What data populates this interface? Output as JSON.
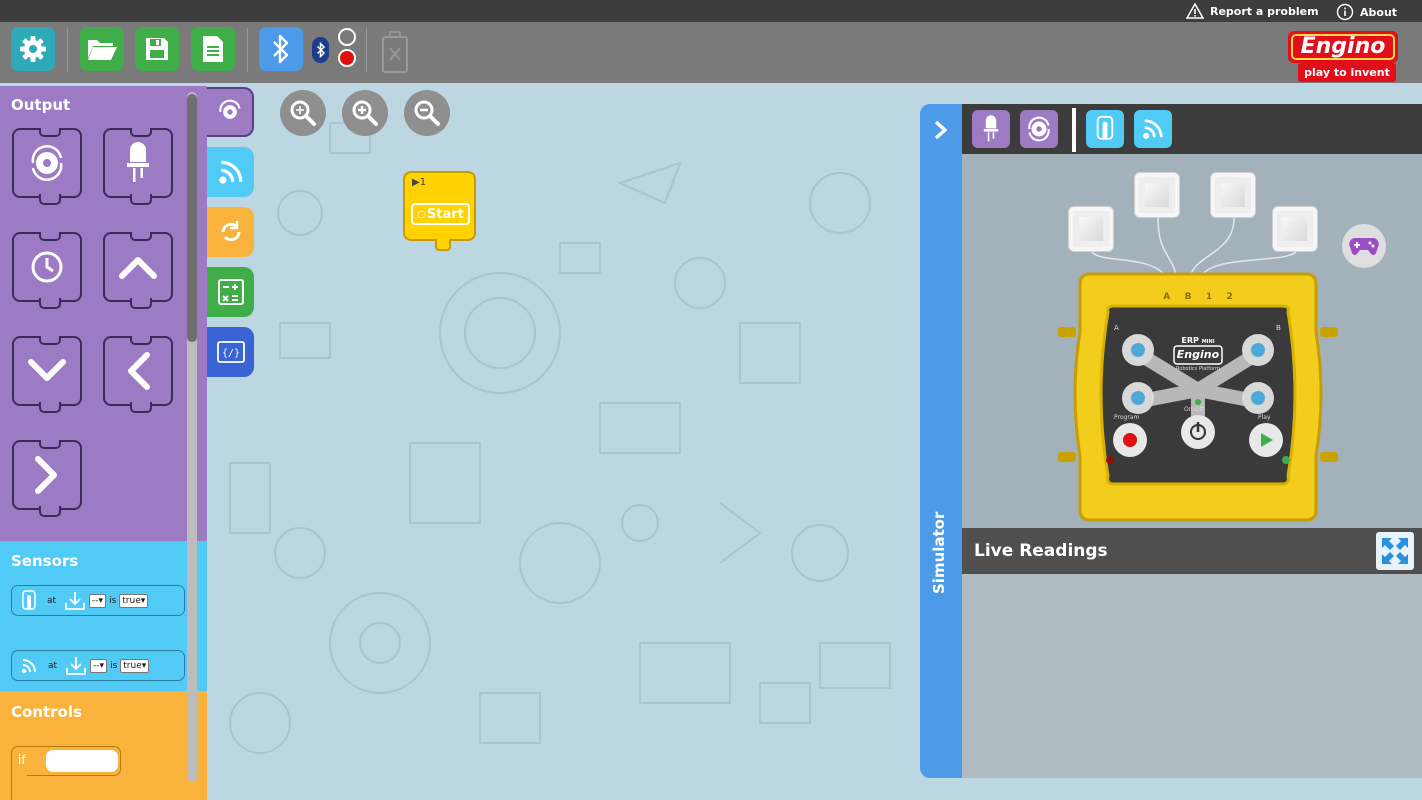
{
  "topbar": {
    "report_label": "Report a problem",
    "about_label": "About"
  },
  "toolbar": {
    "buttons": [
      "settings",
      "open",
      "save",
      "new",
      "bluetooth"
    ]
  },
  "logo": {
    "name": "Engino",
    "tagline": "play to invent"
  },
  "palette": {
    "output": {
      "title": "Output",
      "blocks": [
        "motor",
        "led",
        "timer",
        "up-arrow",
        "down-arrow",
        "left-arrow",
        "right-arrow"
      ]
    },
    "sensors": {
      "title": "Sensors",
      "rows": [
        {
          "at": "at",
          "port": "--",
          "is": "is",
          "value": "true"
        },
        {
          "at": "at",
          "port": "--",
          "is": "is",
          "value": "true"
        }
      ]
    },
    "controls": {
      "title": "Controls",
      "if_label": "if"
    }
  },
  "workspace": {
    "start_block": {
      "index": "▶1",
      "label": "Start"
    }
  },
  "simulator": {
    "tab_label": "Simulator",
    "live_readings": "Live Readings",
    "device": {
      "model": "ERP",
      "model_suffix": "MINI",
      "brand": "Engino",
      "subtitle": "Robotics Platform",
      "port_labels": [
        "A",
        "B",
        "1",
        "2"
      ],
      "labels": {
        "a": "A",
        "b": "B",
        "program": "Program",
        "on_off": "On-Off",
        "play": "Play"
      }
    }
  },
  "colors": {
    "output": "#9c7bc4",
    "sensors": "#51cbf5",
    "controls": "#f9b33c",
    "toolbar_green": "#3fae49",
    "bluetooth": "#4d9be8",
    "start": "#ffd200"
  }
}
